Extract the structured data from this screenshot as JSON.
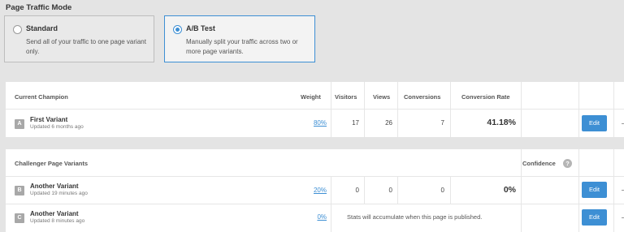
{
  "traffic_mode": {
    "title": "Page Traffic Mode",
    "standard": {
      "label": "Standard",
      "description": "Send all of your traffic to one page variant only.",
      "selected": false
    },
    "ab_test": {
      "label": "A/B Test",
      "description": "Manually split your traffic across two or more page variants.",
      "selected": true
    }
  },
  "champion": {
    "header": "Current Champion",
    "columns": {
      "weight": "Weight",
      "visitors": "Visitors",
      "views": "Views",
      "conversions": "Conversions",
      "conversion_rate": "Conversion Rate"
    },
    "variant": {
      "badge": "A",
      "name": "First Variant",
      "updated": "Updated 6 months ago",
      "weight": "80%",
      "visitors": "17",
      "views": "26",
      "conversions": "7",
      "conversion_rate": "41.18%",
      "edit_label": "Edit"
    }
  },
  "challengers": {
    "header": "Challenger Page Variants",
    "confidence_label": "Confidence",
    "help_icon": "?",
    "variants": [
      {
        "badge": "B",
        "name": "Another Variant",
        "updated": "Updated 19 minutes ago",
        "weight": "20%",
        "visitors": "0",
        "views": "0",
        "conversions": "0",
        "conversion_rate": "0%",
        "edit_label": "Edit"
      },
      {
        "badge": "C",
        "name": "Another Variant",
        "updated": "Updated 8 minutes ago",
        "weight": "0%",
        "note": "Stats will accumulate when this page is published.",
        "edit_label": "Edit"
      }
    ]
  },
  "colors": {
    "accent": "#3d8fd4",
    "badge": "#a8a8a8",
    "background": "#e4e4e4"
  }
}
